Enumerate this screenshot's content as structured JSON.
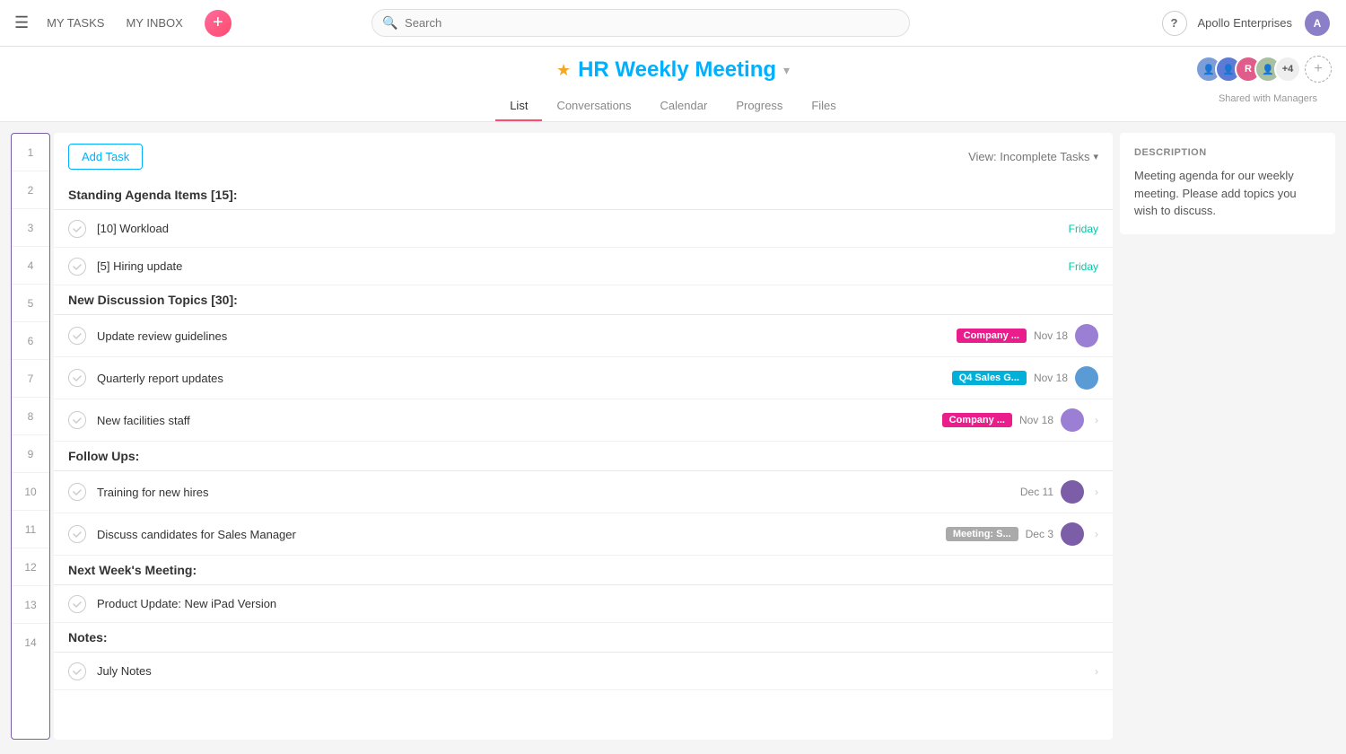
{
  "nav": {
    "my_tasks": "MY TASKS",
    "my_inbox": "MY INBOX",
    "search_placeholder": "Search",
    "company": "Apollo Enterprises",
    "help": "?"
  },
  "title_area": {
    "project_title": "HR Weekly Meeting",
    "chevron": "▾",
    "star": "★",
    "tabs": [
      "List",
      "Conversations",
      "Calendar",
      "Progress",
      "Files"
    ],
    "active_tab": 0,
    "shared_label": "Shared with Managers"
  },
  "toolbar": {
    "add_task": "Add Task",
    "view_label": "View: Incomplete Tasks",
    "view_chevron": "▾"
  },
  "description": {
    "title": "DESCRIPTION",
    "text": "Meeting agenda for our weekly meeting. Please add topics you wish to discuss."
  },
  "sections": [
    {
      "type": "section",
      "row": 1,
      "label": "Standing Agenda Items [15]:"
    },
    {
      "type": "task",
      "row": 2,
      "name": "[10] Workload",
      "date": "Friday",
      "date_color": "teal",
      "tag": null,
      "avatar": null
    },
    {
      "type": "task",
      "row": 3,
      "name": "[5] Hiring update",
      "date": "Friday",
      "date_color": "teal",
      "tag": null,
      "avatar": null
    },
    {
      "type": "section",
      "row": 4,
      "label": "New Discussion Topics [30]:"
    },
    {
      "type": "task",
      "row": 5,
      "name": "Update review guidelines",
      "date": "Nov 18",
      "date_color": "gray",
      "tag": "Company ...",
      "tag_color": "pink",
      "avatar": "s1",
      "has_chevron": false
    },
    {
      "type": "task",
      "row": 6,
      "name": "Quarterly report updates",
      "date": "Nov 18",
      "date_color": "gray",
      "tag": "Q4 Sales G...",
      "tag_color": "teal",
      "avatar": "s2",
      "has_chevron": false
    },
    {
      "type": "task",
      "row": 7,
      "name": "New facilities staff",
      "date": "Nov 18",
      "date_color": "gray",
      "tag": "Company ...",
      "tag_color": "pink",
      "avatar": "s1",
      "has_chevron": true
    },
    {
      "type": "section",
      "row": 8,
      "label": "Follow Ups:"
    },
    {
      "type": "task",
      "row": 9,
      "name": "Training for new hires",
      "date": "Dec 11",
      "date_color": "gray",
      "tag": null,
      "avatar": "s3",
      "has_chevron": true
    },
    {
      "type": "task",
      "row": 10,
      "name": "Discuss candidates for Sales Manager",
      "date": "Dec 3",
      "date_color": "gray",
      "tag": "Meeting: S...",
      "tag_color": "gray",
      "avatar": "s3",
      "has_chevron": true
    },
    {
      "type": "section",
      "row": 11,
      "label": "Next Week's Meeting:"
    },
    {
      "type": "task",
      "row": 12,
      "name": "Product Update: New iPad Version",
      "date": null,
      "tag": null,
      "avatar": null
    },
    {
      "type": "section",
      "row": 13,
      "label": "Notes:"
    },
    {
      "type": "task",
      "row": 14,
      "name": "July Notes",
      "date": null,
      "tag": null,
      "avatar": null,
      "has_chevron": true
    }
  ],
  "row_numbers": [
    1,
    2,
    3,
    4,
    5,
    6,
    7,
    8,
    9,
    10,
    11,
    12,
    13,
    14
  ]
}
